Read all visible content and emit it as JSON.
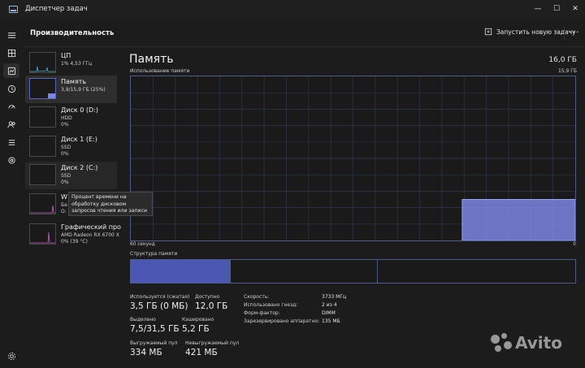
{
  "window": {
    "title": "Диспетчер задач",
    "minimize": "—",
    "maximize": "☐",
    "close": "✕"
  },
  "nav": {
    "items": [
      {
        "icon": "hamburger-icon"
      },
      {
        "icon": "processes-icon"
      },
      {
        "icon": "performance-icon",
        "active": true
      },
      {
        "icon": "app-history-icon"
      },
      {
        "icon": "startup-apps-icon"
      },
      {
        "icon": "users-icon"
      },
      {
        "icon": "details-icon"
      },
      {
        "icon": "services-icon"
      },
      {
        "icon": "settings-icon"
      }
    ]
  },
  "header": {
    "title": "Производительность",
    "new_task": "Запустить новую задачу",
    "more": "···"
  },
  "devices": [
    {
      "name": "ЦП",
      "sub1": "1% 4,53 ГГц",
      "sub2": "",
      "selected": false
    },
    {
      "name": "Память",
      "sub1": "3,9/15,9 ГБ (25%)",
      "sub2": "",
      "selected": true
    },
    {
      "name": "Диск 0 (D:)",
      "sub1": "HDD",
      "sub2": "0%",
      "selected": false
    },
    {
      "name": "Диск 1 (E:)",
      "sub1": "SSD",
      "sub2": "0%",
      "selected": false
    },
    {
      "name": "Диск 2 (C:)",
      "sub1": "SSD",
      "sub2": "0%",
      "selected": false
    },
    {
      "name": "W",
      "sub1": "Бе",
      "sub2": "О:",
      "selected": false
    },
    {
      "name": "Графический про",
      "sub1": "AMD Radeon RX 6700 X",
      "sub2": "0% (39 °C)",
      "selected": false
    }
  ],
  "tooltip": "Процент времени на обработку дисковом запросов чтения или записи",
  "memory": {
    "title": "Память",
    "total": "16,0 ГБ",
    "usage_label": "Использование памяти",
    "usage_max": "15,9 ГБ",
    "axis_left": "60 секунд",
    "axis_right": "0",
    "structure_label": "Структура памяти",
    "usage_history_fraction": [
      0,
      0,
      0,
      0,
      0,
      0,
      0,
      0,
      0,
      0,
      0,
      0,
      0,
      0,
      0,
      0,
      0,
      0,
      0,
      0,
      0,
      0,
      0,
      0,
      0,
      0,
      0,
      0,
      0,
      0,
      0,
      0,
      0,
      0,
      0,
      0,
      0,
      0,
      0,
      0,
      0,
      0,
      0,
      0,
      0.25,
      0.25,
      0.25,
      0.25,
      0.25,
      0.25,
      0.25,
      0.25,
      0.25,
      0.25,
      0.25,
      0.25,
      0.25,
      0.25,
      0.25,
      0.25
    ],
    "structure": {
      "in_use_fraction": 0.22,
      "modified_fraction": 0.005,
      "standby_fraction": 0.33,
      "free_fraction": 0.445
    },
    "stats": {
      "in_use_label": "Используется (сжатая)",
      "in_use_value": "3,5 ГБ (0 МБ)",
      "available_label": "Доступно",
      "available_value": "12,0 ГБ",
      "committed_label": "Выделено",
      "committed_value": "7,5/31,5 ГБ",
      "cached_label": "Кэшировано",
      "cached_value": "5,2 ГБ",
      "paged_label": "Выгружаемый пул",
      "paged_value": "334 МБ",
      "nonpaged_label": "Невыгружаемый пул",
      "nonpaged_value": "421 МБ"
    },
    "details": [
      {
        "label": "Скорость:",
        "value": "3733 МГц"
      },
      {
        "label": "Использовано гнезд:",
        "value": "2 из 4"
      },
      {
        "label": "Форм-фактор:",
        "value": "DIMM"
      },
      {
        "label": "Зарезервировано аппаратно:",
        "value": "135 МБ"
      }
    ]
  },
  "colors": {
    "accent": "#7b86e0",
    "accent_dark": "#4b58b3",
    "graph_border": "#4d5a8c",
    "grid": "#2f3550"
  },
  "watermark": "Avito"
}
